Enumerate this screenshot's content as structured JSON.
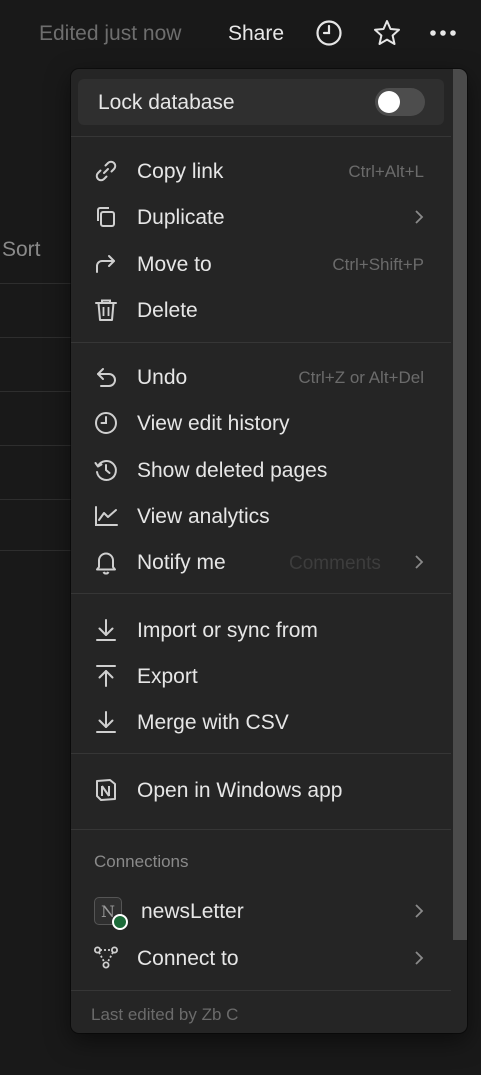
{
  "topbar": {
    "edited": "Edited just now",
    "share": "Share",
    "icons": [
      "clock-icon",
      "star-icon",
      "more-icon"
    ]
  },
  "background": {
    "sort_label": "Sort"
  },
  "menu": {
    "lock": {
      "label": "Lock database",
      "enabled": false
    },
    "group1": [
      {
        "label": "Copy link",
        "shortcut": "Ctrl+Alt+L",
        "icon": "link-icon"
      },
      {
        "label": "Duplicate",
        "shortcut": "",
        "icon": "duplicate-icon",
        "submenu": true
      },
      {
        "label": "Move to",
        "shortcut": "Ctrl+Shift+P",
        "icon": "move-icon"
      },
      {
        "label": "Delete",
        "shortcut": "",
        "icon": "trash-icon"
      }
    ],
    "group2": [
      {
        "label": "Undo",
        "shortcut": "Ctrl+Z or Alt+Del",
        "icon": "undo-icon"
      },
      {
        "label": "View edit history",
        "icon": "clock-icon"
      },
      {
        "label": "Show deleted pages",
        "icon": "restore-icon"
      },
      {
        "label": "View analytics",
        "icon": "analytics-icon"
      },
      {
        "label": "Notify me",
        "sub": "Comments",
        "icon": "bell-icon",
        "submenu": true
      }
    ],
    "group3": [
      {
        "label": "Import or sync from",
        "icon": "import-icon"
      },
      {
        "label": "Export",
        "icon": "export-icon"
      },
      {
        "label": "Merge with CSV",
        "icon": "merge-icon"
      }
    ],
    "group4": [
      {
        "label": "Open in Windows app",
        "icon": "notion-icon"
      }
    ],
    "connections": {
      "title": "Connections",
      "items": [
        {
          "label": "newsLetter",
          "badge": "N",
          "icon": "notion-badge-icon",
          "submenu": true
        },
        {
          "label": "Connect to",
          "icon": "connect-icon",
          "submenu": true
        }
      ]
    },
    "footer": "Last edited by Zb C"
  },
  "colors": {
    "background": "#191919",
    "menu": "#252525",
    "text": "#e6e6e6",
    "muted": "#6b6b6b",
    "status": "#1d6b3a"
  }
}
